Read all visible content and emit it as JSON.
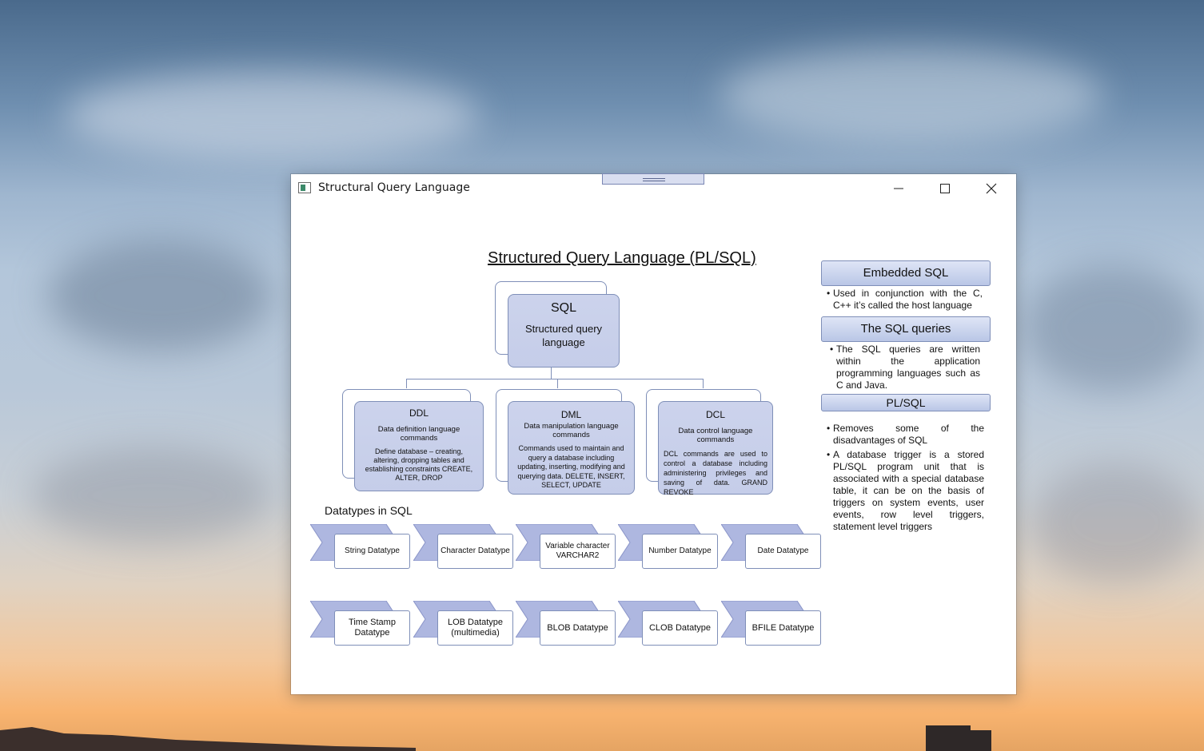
{
  "window": {
    "title": "Structural Query Language",
    "controls": {
      "minimize": "minimize-icon",
      "maximize": "maximize-icon",
      "close": "close-icon"
    }
  },
  "slide": {
    "title": "Structured Query Language (PL/SQL)",
    "root": {
      "title": "SQL",
      "subtitle": "Structured query language"
    },
    "children": [
      {
        "title": "DDL",
        "subtitle": "Data definition language commands",
        "desc": "Define database – creating, altering, dropping tables and establishing constraints CREATE, ALTER, DROP"
      },
      {
        "title": "DML",
        "subtitle": "Data manipulation language commands",
        "desc": "Commands used to maintain and query a database including updating, inserting, modifying and querying data. DELETE, INSERT, SELECT, UPDATE"
      },
      {
        "title": "DCL",
        "subtitle": "Data control language commands",
        "desc": "DCL commands are used to control a database including administering privileges and saving of data. GRAND REVOKE"
      }
    ],
    "datatypes_heading": "Datatypes in SQL",
    "datatypes_row1": [
      "String Datatype",
      "Character Datatype",
      "Variable character VARCHAR2",
      "Number Datatype",
      "Date Datatype"
    ],
    "datatypes_row2": [
      "Time Stamp Datatype",
      "LOB Datatype (multimedia)",
      "BLOB Datatype",
      "CLOB Datatype",
      "BFILE Datatype"
    ],
    "side": {
      "embedded_heading": "Embedded SQL",
      "embedded_text": "Used in conjunction with the C, C++ it’s called the host language",
      "queries_heading": "The SQL queries",
      "queries_text": "The SQL queries are written within the application programming languages such as C and Java.",
      "plsql_heading": "PL/SQL",
      "plsql_bullets": [
        "Removes some of the disadvantages of SQL",
        "A database trigger is a stored PL/SQL program unit that is associated with a special database table, it can be on the basis of triggers on system events, user events, row level triggers, statement level triggers"
      ]
    },
    "colors": {
      "box_fill": "#c5cde9",
      "box_border": "#7f8fb8"
    }
  }
}
